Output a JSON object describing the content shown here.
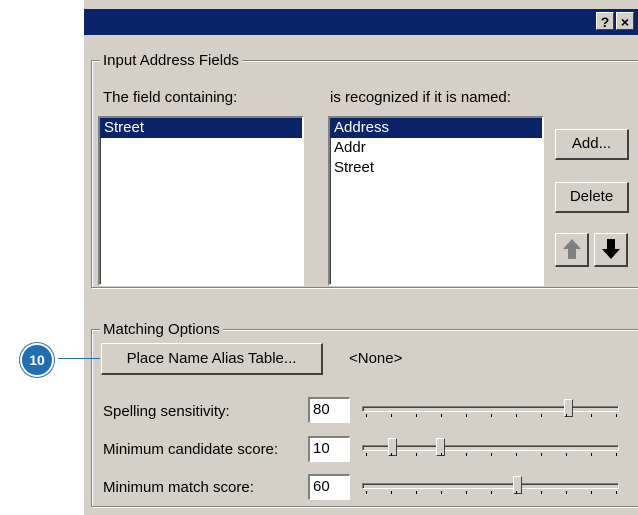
{
  "titlebar": {
    "help_label": "?",
    "close_label": "×"
  },
  "input_group": {
    "legend": "Input Address Fields",
    "left_label": "The field containing:",
    "right_label": "is recognized if it is named:",
    "fields": [
      {
        "label": "Street",
        "selected": true
      }
    ],
    "aliases": [
      {
        "label": "Address",
        "selected": true
      },
      {
        "label": "Addr",
        "selected": false
      },
      {
        "label": "Street",
        "selected": false
      }
    ],
    "add_label": "Add...",
    "delete_label": "Delete",
    "up_icon": "arrow-up-icon",
    "down_icon": "arrow-down-icon"
  },
  "matching_group": {
    "legend": "Matching Options",
    "alias_button_label": "Place Name Alias Table...",
    "alias_value": "<None>",
    "spelling_label": "Spelling sensitivity:",
    "spelling_value": "80",
    "min_candidate_label": "Minimum candidate score:",
    "min_candidate_value": "10",
    "min_match_label": "Minimum match score:",
    "min_match_value": "60"
  },
  "callout": {
    "number": "10",
    "color": "#1f6fb5"
  }
}
